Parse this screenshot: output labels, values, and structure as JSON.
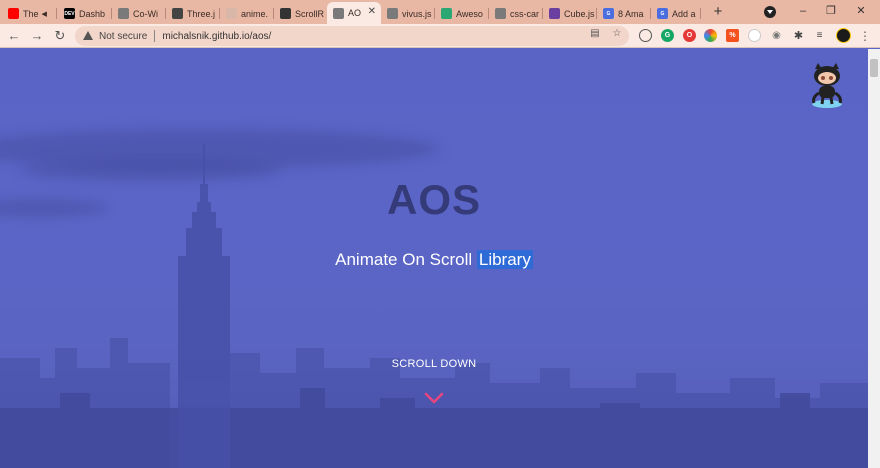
{
  "browser": {
    "tabs": [
      {
        "title": "The",
        "favicon": "youtube-icon",
        "color": "#ff0000",
        "audio": true
      },
      {
        "title": "Dashb",
        "favicon": "dev-icon",
        "color": "#000000",
        "glyph": "DEV"
      },
      {
        "title": "Co-Wi",
        "favicon": "globe-icon",
        "color": "#7a7a7a"
      },
      {
        "title": "Three.j",
        "favicon": "threejs-icon",
        "color": "#444444"
      },
      {
        "title": "anime.",
        "favicon": "anime-icon",
        "color": "#d9b7a8"
      },
      {
        "title": "ScrollR",
        "favicon": "scrollreveal-icon",
        "color": "#333333"
      },
      {
        "title": "AO",
        "favicon": "globe-icon",
        "color": "#7a7a7a",
        "active": true
      },
      {
        "title": "vivus.js",
        "favicon": "globe-icon",
        "color": "#7a7a7a"
      },
      {
        "title": "Aweso",
        "favicon": "awesome-icon",
        "color": "#2aa772"
      },
      {
        "title": "css-car",
        "favicon": "globe-icon",
        "color": "#7a7a7a"
      },
      {
        "title": "Cube.js",
        "favicon": "cube-icon",
        "color": "#6b3fa0"
      },
      {
        "title": "8 Ama",
        "favicon": "g-icon",
        "color": "#4a6ee0",
        "glyph": "G"
      },
      {
        "title": "Add a",
        "favicon": "g-icon",
        "color": "#4a6ee0",
        "glyph": "G"
      }
    ],
    "new_tab_label": "+",
    "address": {
      "security_label": "Not secure",
      "url": "michalsnik.github.io/aos/"
    }
  },
  "page": {
    "title": "AOS",
    "subtitle_main": "Animate On Scroll ",
    "subtitle_highlight": "Library",
    "scroll_label": "SCROLL DOWN"
  },
  "colors": {
    "accent_chevron": "#e8457e",
    "title": "#353a78",
    "background": "#5b64c4"
  }
}
